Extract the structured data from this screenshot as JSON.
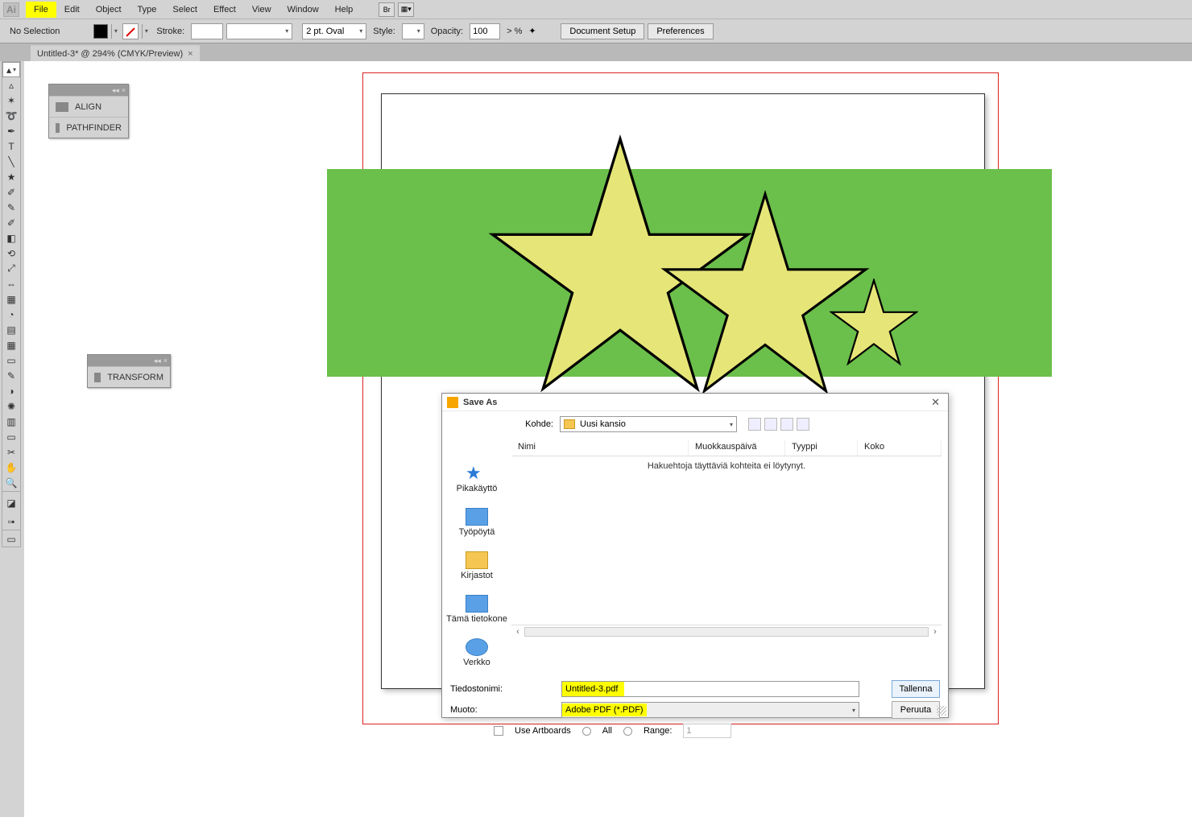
{
  "menu": {
    "items": [
      "File",
      "Edit",
      "Object",
      "Type",
      "Select",
      "Effect",
      "View",
      "Window",
      "Help"
    ],
    "highlight": "File"
  },
  "control": {
    "selection": "No Selection",
    "stroke_label": "Stroke:",
    "dash": "2 pt. Oval",
    "style_label": "Style:",
    "opacity_label": "Opacity:",
    "opacity_value": "100",
    "opacity_pct": "%",
    "doc_setup": "Document Setup",
    "preferences": "Preferences"
  },
  "tab": {
    "title": "Untitled-3* @ 294% (CMYK/Preview)",
    "close": "×"
  },
  "panels": {
    "align": "ALIGN",
    "pathfinder": "PATHFINDER",
    "transform": "TRANSFORM"
  },
  "tools": [
    "▲",
    "✶",
    "⌖",
    "✎",
    "T",
    "／",
    "★",
    "✐",
    "／",
    "✎",
    "◌",
    "⟲",
    "⇔",
    "▦",
    "▤",
    "◧",
    "▭",
    "▭",
    "◢",
    "✚",
    "／",
    "✋",
    "🔍"
  ],
  "dialog": {
    "title": "Save As",
    "kohde_label": "Kohde:",
    "kohde_value": "Uusi kansio",
    "cols": {
      "nimi": "Nimi",
      "muok": "Muokkauspäivä",
      "tyyppi": "Tyyppi",
      "koko": "Koko"
    },
    "empty_msg": "Hakuehtoja täyttäviä kohteita ei löytynyt.",
    "side": {
      "pika": "Pikakäyttö",
      "tyo": "Työpöytä",
      "kirj": "Kirjastot",
      "tama": "Tämä tietokone",
      "verkko": "Verkko"
    },
    "file_label": "Tiedostonimi:",
    "file_value": "Untitled-3.pdf",
    "format_label": "Muoto:",
    "format_value": "Adobe PDF (*.PDF)",
    "use_artboards": "Use Artboards",
    "all": "All",
    "range": "Range:",
    "range_value": "1",
    "save_btn": "Tallenna",
    "cancel_btn": "Peruuta"
  }
}
